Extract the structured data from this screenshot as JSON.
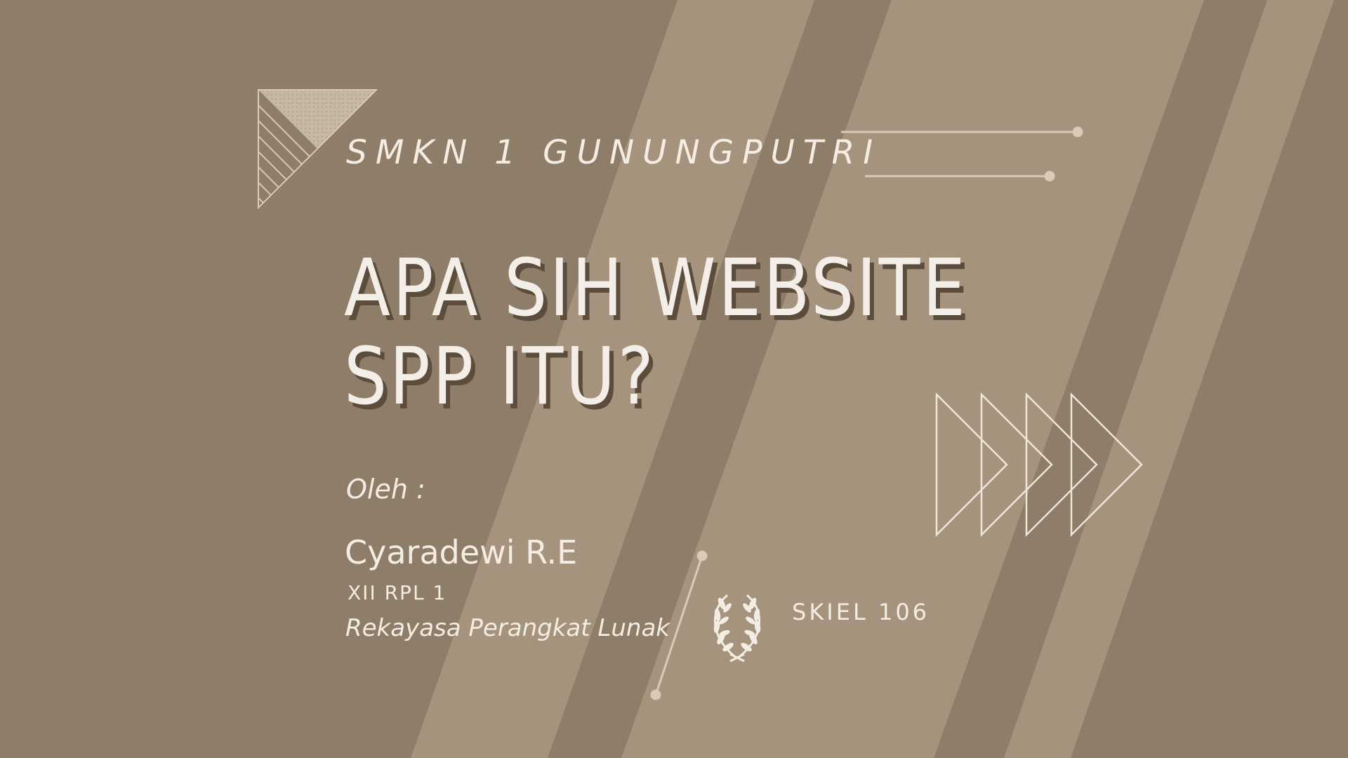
{
  "slide": {
    "school": "SMKN 1 GUNUNGPUTRI",
    "title_line1": "APA SIH WEBSITE",
    "title_line2": "SPP ITU?",
    "by_label": "Oleh :",
    "author": "Cyaradewi R.E",
    "class": "XII RPL 1",
    "major": "Rekayasa Perangkat Lunak",
    "room": "SKIEL 106"
  },
  "colors": {
    "background": "#8d7d69",
    "stripe_light": "#a5937d",
    "text": "#f4ede3",
    "title_shadow": "#5b4c3c",
    "accent_line": "#d9cbb8"
  },
  "icons": [
    "triangle-pattern-icon",
    "triangles-arrow-icon",
    "laurel-wreath-icon"
  ]
}
